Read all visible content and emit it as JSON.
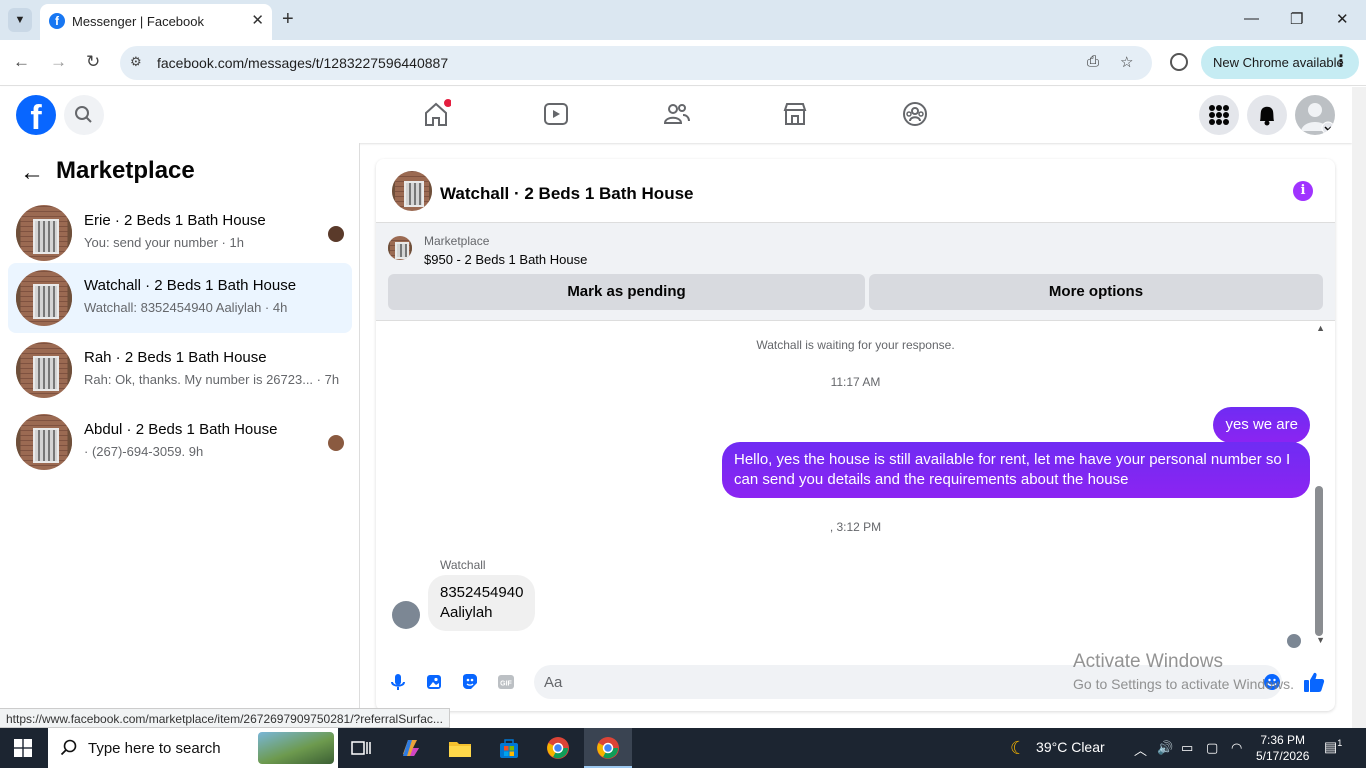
{
  "browser": {
    "tab_title": "Messenger | Facebook",
    "url": "facebook.com/messages/t/1283227596440887",
    "chrome_update_label": "New Chrome available",
    "status_url": "https://www.facebook.com/marketplace/item/2672697909750281/?referralSurfac..."
  },
  "fb": {
    "logo": "f"
  },
  "sidebar": {
    "title": "Marketplace",
    "conversations": [
      {
        "name": "Erie · 2 Beds 1 Bath House",
        "snippet": "You: send your number · 1h",
        "active": false
      },
      {
        "name": "Watchall · 2 Beds 1 Bath House",
        "snippet": "Watchall: 8352454940 Aaliylah · 4h",
        "active": true
      },
      {
        "name": "Rah · 2 Beds 1 Bath House",
        "snippet": "Rah: Ok, thanks. My number is 26723...  · 7h",
        "active": false
      },
      {
        "name": "Abdul · 2 Beds 1 Bath House",
        "snippet": "· (267)-694-3059. 9h",
        "active": false
      }
    ]
  },
  "chat": {
    "title": "Watchall · 2 Beds 1 Bath House",
    "marketplace_label": "Marketplace",
    "listing": "$950 - 2 Beds 1 Bath House",
    "mark_pending_label": "Mark as pending",
    "more_options_label": "More options",
    "waiting_text": "Watchall is waiting for your response.",
    "time1": "11:17 AM",
    "msg_out_1": "yes we are",
    "msg_out_2": "Hello, yes the house is still available for rent, let me have your personal number so I can send you details and the requirements about the house",
    "time2": ", 3:12 PM",
    "sender_name": "Watchall",
    "msg_in_line1": "8352454940",
    "msg_in_line2": "Aaliylah",
    "input_placeholder": "Aa"
  },
  "watermark": {
    "line1": "Activate Windows",
    "line2": "Go to Settings to activate Windows."
  },
  "taskbar": {
    "search_placeholder": "Type here to search",
    "weather": "39°C  Clear",
    "time": "7:36 PM",
    "date": "5/17/2026",
    "notif_count": "1"
  },
  "colors": {
    "fb_blue": "#0866ff",
    "messenger_purple": "#7b28f5",
    "info_purple": "#a033ff"
  }
}
